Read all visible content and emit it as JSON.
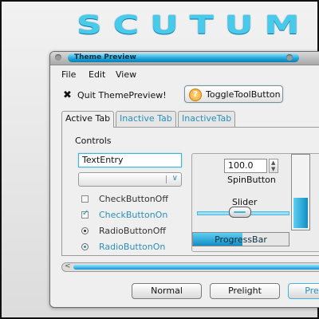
{
  "logo_text": "SCUTUM",
  "window": {
    "title": "Theme Preview"
  },
  "menu": {
    "file": "File",
    "edit": "Edit",
    "view": "View"
  },
  "toolbar": {
    "quit_label": "Quit ThemePreview!",
    "toggle_label": "ToggleToolButton",
    "toggle_icon": "?"
  },
  "tabs": [
    {
      "label": "Active Tab",
      "active": true
    },
    {
      "label": "Inactive Tab",
      "active": false
    },
    {
      "label": "InactiveTab",
      "active": false
    }
  ],
  "controls": {
    "frame_title": "Controls",
    "text_entry": "TextEntry",
    "combo_value": "",
    "check_off": {
      "label": "CheckButtonOff",
      "checked": false
    },
    "check_on": {
      "label": "CheckButtonOn",
      "checked": true
    },
    "radio_off": {
      "label": "RadioButtonOff",
      "selected": false
    },
    "radio_on": {
      "label": "RadioButtonOn",
      "selected": true
    }
  },
  "spin": {
    "value": "100.0",
    "label": "SpinButton"
  },
  "slider": {
    "label": "Slider",
    "value_fraction": 0.45
  },
  "progress": {
    "label": "ProgressBar",
    "value_fraction": 0.52
  },
  "vscale": {
    "value_fraction": 0.45
  },
  "buttons": {
    "normal": "Normal",
    "prelight": "Prelight",
    "pressed_partial": "Pre"
  },
  "colors": {
    "accent": "#1aa2d6",
    "accent_light": "#8fe3ff",
    "text": "#222222"
  }
}
